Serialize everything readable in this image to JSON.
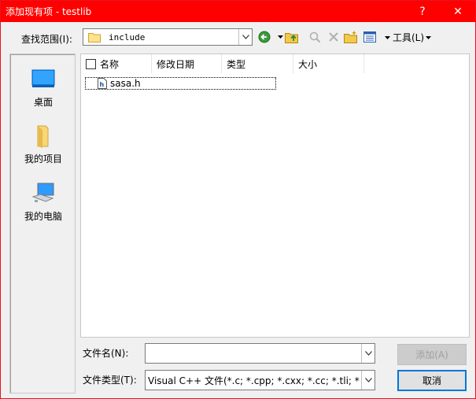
{
  "window": {
    "title": "添加现有项 - testlib",
    "help_glyph": "?",
    "close_glyph": "✕"
  },
  "lookin": {
    "label": "查找范围(I):",
    "value": "include"
  },
  "toolbar": {
    "tools_label": "工具(L)",
    "icons": [
      "back-icon",
      "up-folder-icon",
      "search-web-icon",
      "delete-icon",
      "new-folder-icon",
      "views-icon"
    ]
  },
  "places": [
    {
      "name": "desktop",
      "label": "桌面",
      "icon": "desktop-icon"
    },
    {
      "name": "my-projects",
      "label": "我的项目",
      "icon": "folder-icon"
    },
    {
      "name": "my-computer",
      "label": "我的电脑",
      "icon": "computer-icon"
    }
  ],
  "list": {
    "columns": [
      "名称",
      "修改日期",
      "类型",
      "大小"
    ],
    "files": [
      {
        "name": "sasa.h",
        "icon": "header-file-icon"
      }
    ]
  },
  "filename": {
    "label": "文件名(N):",
    "value": ""
  },
  "filetype": {
    "label": "文件类型(T):",
    "value": "Visual C++ 文件(*.c; *.cpp; *.cxx; *.cc; *.tli; *.tlh; *"
  },
  "buttons": {
    "add": "添加(A)",
    "cancel": "取消"
  },
  "colors": {
    "titlebar": "#ff0000",
    "accent": "#0078d7"
  }
}
